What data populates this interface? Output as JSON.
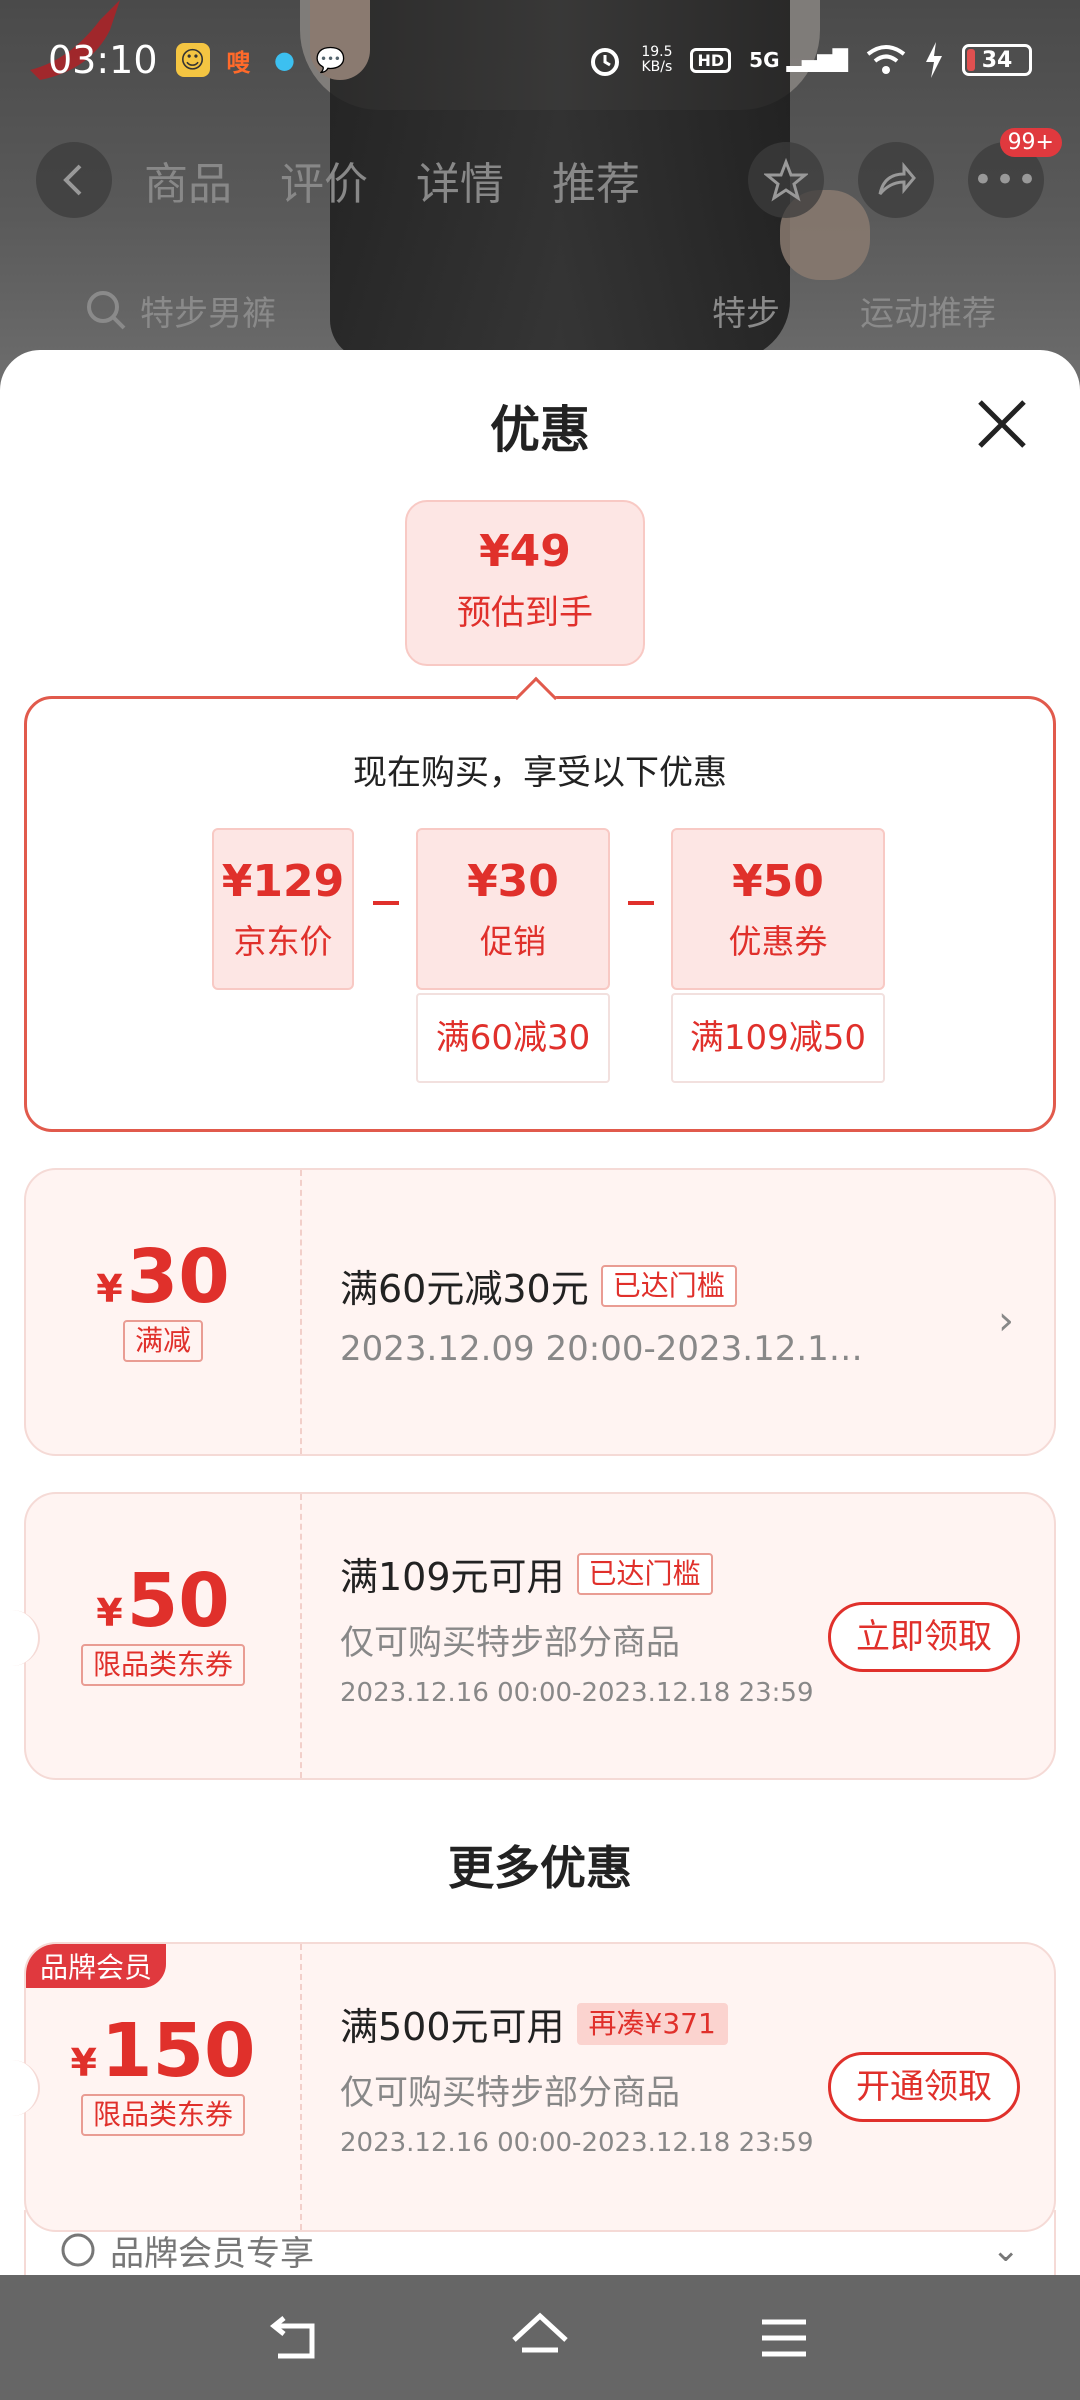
{
  "status_bar": {
    "time": "03:10",
    "app_icons": [
      "QQ-penguin-icon",
      "manhua-icon",
      "qq-icon",
      "message-icon"
    ],
    "manhua_label": "嗖",
    "net_speed": "19.5",
    "net_unit": "KB/s",
    "hd_label": "HD",
    "network": "5G",
    "battery": "34"
  },
  "product_nav": {
    "tabs": [
      "商品",
      "评价",
      "详情",
      "推荐"
    ],
    "badge": "99+"
  },
  "search_bar": {
    "query": "特步男裤",
    "tags": [
      "特步",
      "运动推荐"
    ]
  },
  "sheet": {
    "title": "优惠",
    "estimate": {
      "price": "¥49",
      "label": "预估到手"
    },
    "intro": "现在购买，享受以下优惠",
    "breakdown": [
      {
        "amount": "¥129",
        "label": "京东价",
        "condition": ""
      },
      {
        "amount": "¥30",
        "label": "促销",
        "condition": "满60减30"
      },
      {
        "amount": "¥50",
        "label": "优惠券",
        "condition": "满109减50"
      }
    ],
    "coupons": [
      {
        "yen": "¥",
        "value": "30",
        "type": "满减",
        "condition": "满60元减30元",
        "chip": "已达门槛",
        "desc": "",
        "date": "2023.12.09 20:00-2023.12.1…",
        "action": ""
      },
      {
        "yen": "¥",
        "value": "50",
        "type": "限品类东券",
        "condition": "满109元可用",
        "chip": "已达门槛",
        "desc": "仅可购买特步部分商品",
        "date": "2023.12.16 00:00-2023.12.18 23:59",
        "action": "立即领取"
      }
    ],
    "more_title": "更多优惠",
    "member_coupon": {
      "tag": "品牌会员",
      "yen": "¥",
      "value": "150",
      "type": "限品类东券",
      "condition": "满500元可用",
      "chip": "再凑¥371",
      "desc": "仅可购买特步部分商品",
      "date": "2023.12.16 00:00-2023.12.18 23:59",
      "action": "开通领取"
    },
    "member_row_label": "品牌会员专享"
  },
  "colors": {
    "accent": "#e0302b",
    "pink_bg": "#fde6e4",
    "coupon_bg": "#fff4f2"
  }
}
